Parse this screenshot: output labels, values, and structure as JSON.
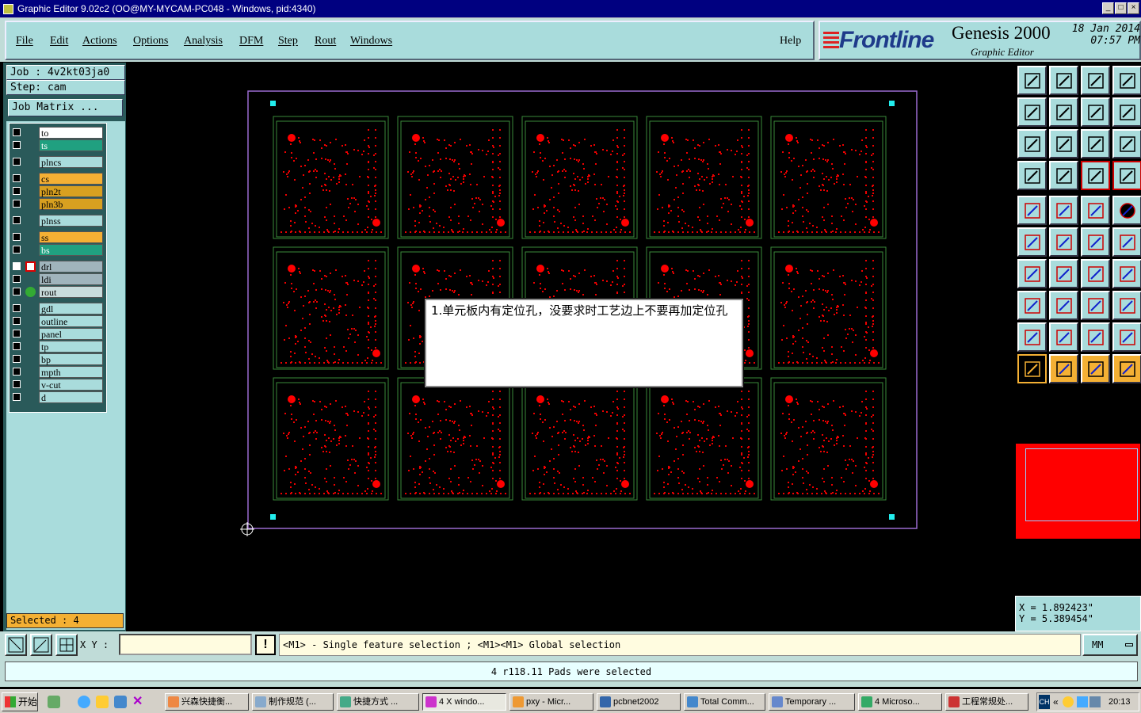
{
  "window": {
    "title": "Graphic Editor 9.02c2  (OO@MY-MYCAM-PC048 - Windows, pid:4340)"
  },
  "menu": {
    "items": [
      "File",
      "Edit",
      "Actions",
      "Options",
      "Analysis",
      "DFM",
      "Step",
      "Rout",
      "Windows"
    ],
    "help": "Help"
  },
  "logo": {
    "brand": "Frontline",
    "product": "Genesis 2000",
    "subtitle": "Graphic Editor",
    "date": "18 Jan 2014",
    "time": "07:57 PM"
  },
  "job": {
    "job_line": "Job : 4v2kt03ja0",
    "step_line": "Step: cam",
    "matrix_button": "Job Matrix ..."
  },
  "layers": [
    {
      "name": "to",
      "color": "#ffffff"
    },
    {
      "name": "ts",
      "color": "#20a080"
    },
    {
      "name": "plncs",
      "color": "#a9dcdc"
    },
    {
      "name": "cs",
      "color": "#f4b034"
    },
    {
      "name": "pln2t",
      "color": "#d8a020"
    },
    {
      "name": "pln3b",
      "color": "#d8a020"
    },
    {
      "name": "plnss",
      "color": "#a9dcdc"
    },
    {
      "name": "ss",
      "color": "#f4b034"
    },
    {
      "name": "bs",
      "color": "#20a080"
    },
    {
      "name": "drl",
      "color": "#a0b4bc"
    },
    {
      "name": "ldi",
      "color": "#a0b4bc"
    },
    {
      "name": "rout",
      "color": "#c8dcdc"
    },
    {
      "name": "gdl",
      "color": "#a9dcdc"
    },
    {
      "name": "outline",
      "color": "#a9dcdc"
    },
    {
      "name": "panel",
      "color": "#a9dcdc"
    },
    {
      "name": "tp",
      "color": "#a9dcdc"
    },
    {
      "name": "bp",
      "color": "#a9dcdc"
    },
    {
      "name": "mpth",
      "color": "#a9dcdc"
    },
    {
      "name": "v-cut",
      "color": "#a9dcdc"
    },
    {
      "name": "d",
      "color": "#a9dcdc"
    }
  ],
  "selected_label": "Selected : 4",
  "popup": {
    "text": "1.单元板内有定位孔，没要求时工艺边上不要再加定位孔"
  },
  "coords": {
    "x": "X  =  1.892423\"",
    "y": "Y  =  5.389454\""
  },
  "command": {
    "xy_label": "X Y :",
    "xy_value": "",
    "hint": "<M1> - Single feature selection ; <M1><M1> Global selection",
    "units": "MM"
  },
  "status": {
    "message": "4 r118.11 Pads were selected"
  },
  "taskbar": {
    "start": "开始",
    "tasks": [
      "兴森快捷衡...",
      "制作规范 (...",
      "快捷方式 ...",
      "4 X windo...",
      "pxy - Micr...",
      "pcbnet2002",
      "Total Comm...",
      "Temporary ...",
      "4 Microso...",
      "工程常规处..."
    ],
    "clock": "20:13",
    "lang": "CH"
  },
  "board": {
    "rows": 3,
    "cols": 5
  }
}
